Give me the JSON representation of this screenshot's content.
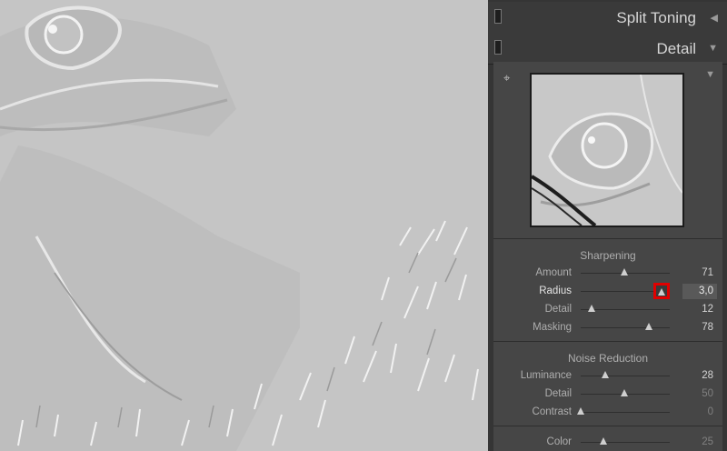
{
  "panels": {
    "split_toning": {
      "title": "Split Toning",
      "collapse_icon": "triangle-left-icon"
    },
    "detail": {
      "title": "Detail",
      "collapse_icon": "triangle-down-icon",
      "target_icon": "crosshair-icon",
      "menu_icon": "triangle-down-icon"
    }
  },
  "sharpening": {
    "title": "Sharpening",
    "amount": {
      "label": "Amount",
      "value": "71",
      "fraction": 0.49
    },
    "radius": {
      "label": "Radius",
      "value": "3,0",
      "fraction": 0.92
    },
    "detail": {
      "label": "Detail",
      "value": "12",
      "fraction": 0.12
    },
    "masking": {
      "label": "Masking",
      "value": "78",
      "fraction": 0.77
    }
  },
  "noise_reduction": {
    "title": "Noise Reduction",
    "luminance": {
      "label": "Luminance",
      "value": "28",
      "fraction": 0.28
    },
    "detail": {
      "label": "Detail",
      "value": "50",
      "fraction": 0.49
    },
    "contrast": {
      "label": "Contrast",
      "value": "0",
      "fraction": 0.0
    },
    "color": {
      "label": "Color",
      "value": "25",
      "fraction": 0.25
    }
  },
  "colors": {
    "highlight_box": "#e00000",
    "photo_bg": "#c4c4c4"
  }
}
